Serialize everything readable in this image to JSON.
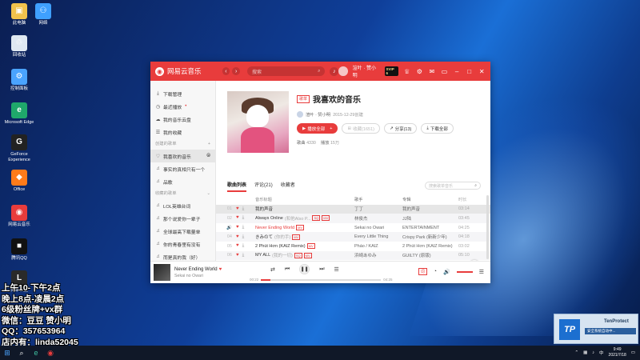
{
  "desktop": {
    "icons": [
      {
        "label": "此电脑",
        "glyph": "▣",
        "color": "#f1c24c"
      },
      {
        "label": "网络",
        "glyph": "⚇",
        "color": "#3fa0ff"
      },
      {
        "label": "回收站",
        "glyph": "♲",
        "color": "#dfe8f2"
      },
      {
        "label": "控制面板",
        "glyph": "⚙",
        "color": "#4aa3ff"
      },
      {
        "label": "Microsoft Edge",
        "glyph": "e",
        "color": "#1fa86b"
      },
      {
        "label": "GeForce Experience",
        "glyph": "G",
        "color": "#222"
      },
      {
        "label": "Office",
        "glyph": "◆",
        "color": "#ff7b1a"
      },
      {
        "label": "网易云音乐",
        "glyph": "◉",
        "color": "#e83c3c"
      },
      {
        "label": "腾讯QQ",
        "glyph": "■",
        "color": "#111"
      },
      {
        "label": "英雄联盟",
        "glyph": "L",
        "color": "#2a2a2a"
      }
    ],
    "overlay_lines": [
      "上午10-下午2点",
      "晚上8点-凌晨2点",
      "6级粉丝牌+vx群",
      "微信：豆豆  赞小明",
      "QQ：357653964",
      "店内有：linda52045"
    ]
  },
  "app": {
    "name": "网易云音乐",
    "search_placeholder": "搜索",
    "user_name": "渲叶 · 赞小明",
    "vip_label": "SVIP 6",
    "sidebar": {
      "top_items": [
        {
          "icon": "⤓",
          "label": "下载管理"
        },
        {
          "icon": "◷",
          "label": "最近播放"
        },
        {
          "icon": "☁",
          "label": "我的音乐云盘"
        },
        {
          "icon": "☰",
          "label": "我的收藏"
        }
      ],
      "created_header": "创建的歌单",
      "created_items": [
        {
          "icon": "♡",
          "label": "我喜欢的音乐"
        },
        {
          "icon": "♫",
          "label": "事实的真相只有一个"
        },
        {
          "icon": "♫",
          "label": "品歌"
        }
      ],
      "collected_header": "收藏的歌单",
      "collected_items": [
        {
          "icon": "♫",
          "label": "LOL英雄台词"
        },
        {
          "icon": "♫",
          "label": "那个说爱你一辈子"
        },
        {
          "icon": "♫",
          "label": "全球最高下载量单"
        },
        {
          "icon": "♫",
          "label": "你的青春里有没有"
        },
        {
          "icon": "♫",
          "label": "而是真的我（好）"
        }
      ]
    },
    "playlist": {
      "tag": "歌单",
      "title": "我喜欢的音乐",
      "creator": "渲叶 · 赞小明",
      "created_time": "2015-12-29创建",
      "play_all": "播放全部",
      "collect": "收藏(1651)",
      "share": "分享(13)",
      "download_all": "下载全部",
      "songs_label": "歌曲",
      "songs_count": "4330",
      "plays_label": "播放",
      "plays_count": "15万"
    },
    "tabs": [
      "歌曲列表",
      "评论(21)",
      "收藏者"
    ],
    "list_search_placeholder": "搜索歌单音乐",
    "table": {
      "headers": [
        "音乐标题",
        "歌手",
        "专辑",
        "时长"
      ],
      "rows": [
        {
          "idx": "01",
          "title": "我的声音",
          "sub": "",
          "badges": [],
          "artist": "丁丁",
          "album": "我的声音",
          "time": "03:14"
        },
        {
          "idx": "02",
          "title": "Always Online",
          "sub": "(和他Also P...",
          "badges": [
            "SQ",
            "MV"
          ],
          "artist": "林俊杰",
          "album": "JJ陆",
          "time": "03:45"
        },
        {
          "idx": "03",
          "title": "Never Ending World",
          "sub": "",
          "badges": [
            "MV"
          ],
          "artist": "Sekai no Owari",
          "album": "ENTERTAINMENT",
          "time": "04:25"
        },
        {
          "idx": "04",
          "title": "きみのて",
          "sub": "(你的手)",
          "badges": [
            "MV"
          ],
          "artist": "Every Little Thing",
          "album": "Crispy Park (新新少年)",
          "time": "04:18"
        },
        {
          "idx": "05",
          "title": "2 Phút Hơn (KAIZ Remix)",
          "sub": "",
          "badges": [
            "MV"
          ],
          "artist": "Pháo / KAIZ",
          "album": "2 Phút Hơn (KAIZ Remix)",
          "time": "03:02"
        },
        {
          "idx": "06",
          "title": "MY ALL",
          "sub": "(我的一切)",
          "badges": [
            "SQ",
            "MV"
          ],
          "artist": "浜崎あゆみ",
          "album": "GUILTY (原版)",
          "time": "05:10"
        },
        {
          "idx": "07",
          "title": "Lydia",
          "sub": "",
          "badges": [
            "SQ",
            "MV"
          ],
          "artist": "F.I.R.",
          "album": "F.I.R.飞儿乐团",
          "time": "04:28"
        }
      ]
    },
    "player": {
      "now_title": "Never Ending World",
      "now_artist": "Sekai no Owari",
      "current_time": "00:22",
      "total_time": "04:25",
      "progress": 0.08,
      "lyric_label": "词"
    }
  },
  "toast": {
    "title": "TenProtect",
    "subtitle": "安全系统自动中..."
  },
  "taskbar": {
    "time": "9:49",
    "date": "2021/7/18",
    "ime": "中"
  }
}
